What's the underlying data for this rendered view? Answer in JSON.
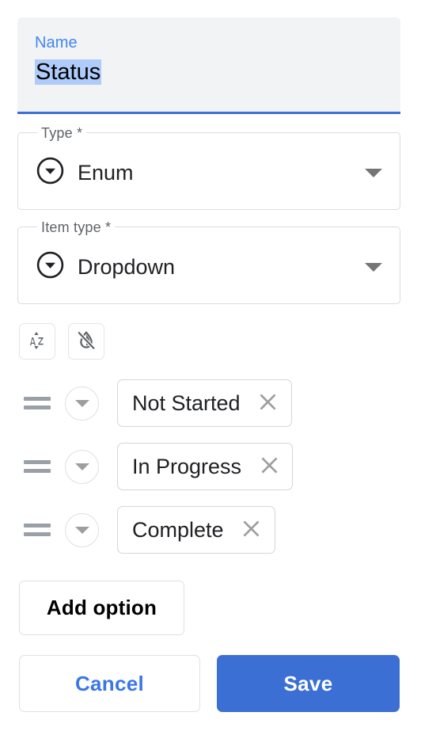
{
  "colors": {
    "accent_blue": "#3b6fd4",
    "link_blue": "#4285f4",
    "selection_blue": "#aecbfa",
    "panel_gray": "#f1f3f4",
    "border_gray": "#dadce0",
    "icon_gray": "#5f6368",
    "text_black": "#202124"
  },
  "name_field": {
    "label": "Name",
    "value": "Status",
    "selected": true
  },
  "type_field": {
    "label": "Type *",
    "value": "Enum",
    "leading_icon": "arrow-drop-down-circle-icon",
    "trailing_icon": "chevron-down-icon"
  },
  "item_type_field": {
    "label": "Item type *",
    "value": "Dropdown",
    "leading_icon": "arrow-drop-down-circle-icon",
    "trailing_icon": "chevron-down-icon"
  },
  "toolbar": {
    "buttons": [
      {
        "name": "sort-alphabetically-button",
        "icon": "sort-by-alpha-icon",
        "label": "AZ"
      },
      {
        "name": "invert-colors-off-button",
        "icon": "invert-colors-off-icon",
        "label": ""
      }
    ]
  },
  "options": {
    "items": [
      {
        "value": "Not Started",
        "drag_icon": "drag-handle-icon",
        "menu_icon": "arrow-drop-down-icon",
        "clear_icon": "close-icon"
      },
      {
        "value": "In Progress",
        "drag_icon": "drag-handle-icon",
        "menu_icon": "arrow-drop-down-icon",
        "clear_icon": "close-icon"
      },
      {
        "value": "Complete",
        "drag_icon": "drag-handle-icon",
        "menu_icon": "arrow-drop-down-icon",
        "clear_icon": "close-icon"
      }
    ],
    "add_label": "Add option"
  },
  "footer": {
    "cancel_label": "Cancel",
    "save_label": "Save"
  }
}
